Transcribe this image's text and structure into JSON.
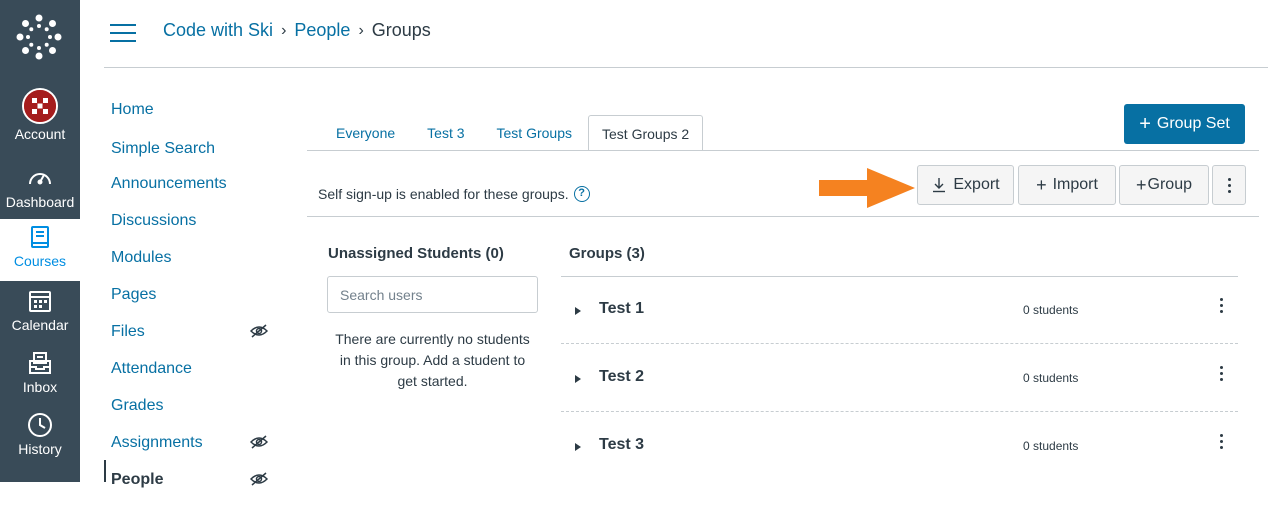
{
  "global_nav": {
    "items": [
      {
        "label": "Account",
        "icon": "account-avatar"
      },
      {
        "label": "Dashboard",
        "icon": "dashboard-icon"
      },
      {
        "label": "Courses",
        "icon": "courses-icon"
      },
      {
        "label": "Calendar",
        "icon": "calendar-icon"
      },
      {
        "label": "Inbox",
        "icon": "inbox-icon"
      },
      {
        "label": "History",
        "icon": "history-icon"
      }
    ]
  },
  "breadcrumb": {
    "course": "Code with Ski",
    "section": "People",
    "current": "Groups"
  },
  "course_nav": {
    "items": [
      {
        "label": "Home"
      },
      {
        "label": "Simple Search"
      },
      {
        "label": "Announcements"
      },
      {
        "label": "Discussions"
      },
      {
        "label": "Modules"
      },
      {
        "label": "Pages"
      },
      {
        "label": "Files"
      },
      {
        "label": "Attendance"
      },
      {
        "label": "Grades"
      },
      {
        "label": "Assignments"
      },
      {
        "label": "People"
      }
    ]
  },
  "tabs": [
    {
      "label": "Everyone"
    },
    {
      "label": "Test 3"
    },
    {
      "label": "Test Groups"
    },
    {
      "label": "Test Groups 2"
    }
  ],
  "group_set_button": "Group Set",
  "self_signup_text": "Self sign-up is enabled for these groups.",
  "toolbar": {
    "export": "Export",
    "import": "Import",
    "group": "Group"
  },
  "unassigned": {
    "title": "Unassigned Students (0)",
    "search_placeholder": "Search users",
    "empty_message": "There are currently no students in this group. Add a student to get started."
  },
  "groups": {
    "title": "Groups (3)",
    "items": [
      {
        "name": "Test 1",
        "count": "0 students"
      },
      {
        "name": "Test 2",
        "count": "0 students"
      },
      {
        "name": "Test 3",
        "count": "0 students"
      }
    ]
  },
  "colors": {
    "nav_bg": "#394b58",
    "link": "#0770a3",
    "primary_button": "#0770a3",
    "annotation_arrow": "#f58220"
  }
}
